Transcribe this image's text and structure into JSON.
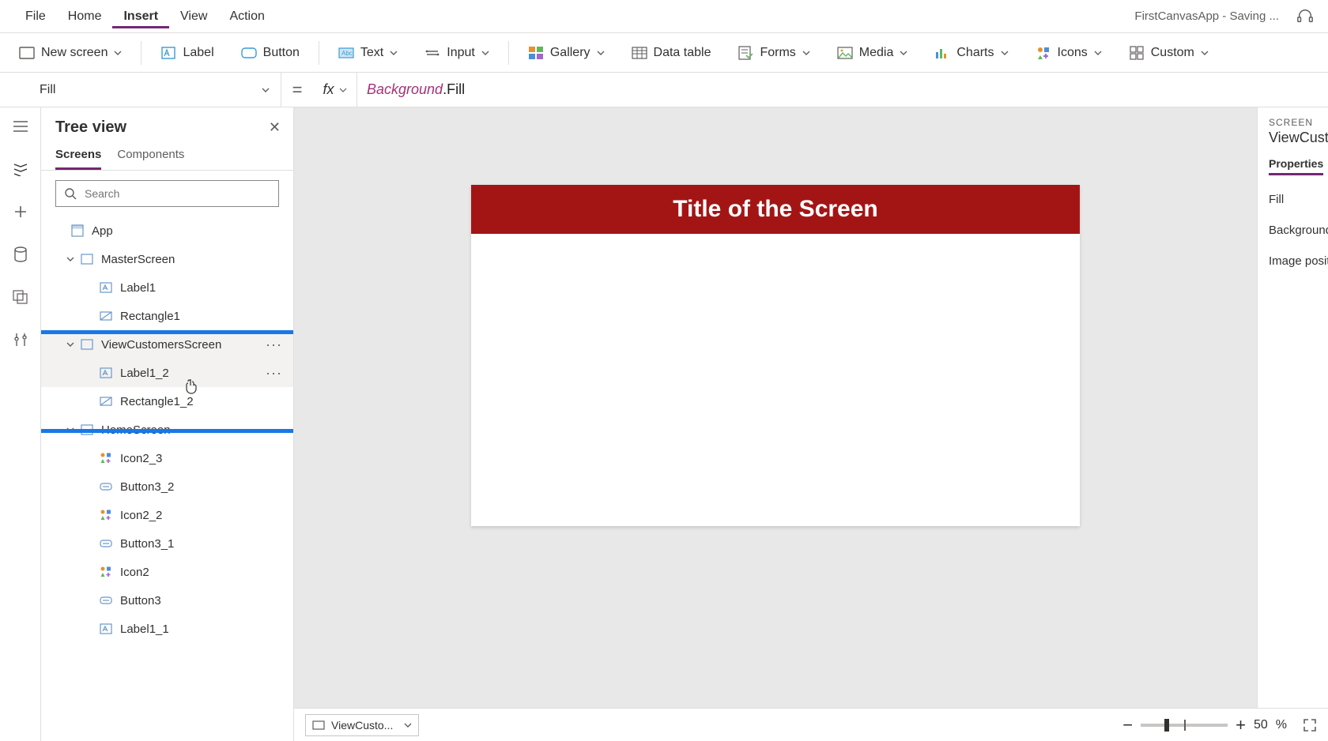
{
  "topbar": {
    "menus": [
      "File",
      "Home",
      "Insert",
      "View",
      "Action"
    ],
    "activeIndex": 2,
    "appTitle": "FirstCanvasApp - Saving ..."
  },
  "ribbon": {
    "newScreen": "New screen",
    "label": "Label",
    "button": "Button",
    "text": "Text",
    "input": "Input",
    "gallery": "Gallery",
    "dataTable": "Data table",
    "forms": "Forms",
    "media": "Media",
    "charts": "Charts",
    "icons": "Icons",
    "custom": "Custom"
  },
  "formula": {
    "property": "Fill",
    "eq": "=",
    "fx": "fx",
    "object": "Background",
    "member": ".Fill"
  },
  "treePanel": {
    "title": "Tree view",
    "tabs": {
      "screens": "Screens",
      "components": "Components",
      "activeIndex": 0
    },
    "searchPlaceholder": "Search",
    "items": [
      {
        "label": "App",
        "depth": 0,
        "type": "app",
        "hasChevron": false
      },
      {
        "label": "MasterScreen",
        "depth": 1,
        "type": "screen",
        "hasChevron": true
      },
      {
        "label": "Label1",
        "depth": 2,
        "type": "label"
      },
      {
        "label": "Rectangle1",
        "depth": 2,
        "type": "rect"
      },
      {
        "label": "ViewCustomersScreen",
        "depth": 1,
        "type": "screen",
        "hasChevron": true,
        "hover": true,
        "showMore": true
      },
      {
        "label": "Label1_2",
        "depth": 2,
        "type": "label",
        "hover": true,
        "showMore": true
      },
      {
        "label": "Rectangle1_2",
        "depth": 2,
        "type": "rect"
      },
      {
        "label": "HomeScreen",
        "depth": 1,
        "type": "screen",
        "hasChevron": true
      },
      {
        "label": "Icon2_3",
        "depth": 2,
        "type": "icon"
      },
      {
        "label": "Button3_2",
        "depth": 2,
        "type": "button"
      },
      {
        "label": "Icon2_2",
        "depth": 2,
        "type": "icon"
      },
      {
        "label": "Button3_1",
        "depth": 2,
        "type": "button"
      },
      {
        "label": "Icon2",
        "depth": 2,
        "type": "icon"
      },
      {
        "label": "Button3",
        "depth": 2,
        "type": "button"
      },
      {
        "label": "Label1_1",
        "depth": 2,
        "type": "label"
      }
    ]
  },
  "canvas": {
    "titleText": "Title of the Screen",
    "titleBg": "#a31515"
  },
  "props": {
    "caption": "SCREEN",
    "name": "ViewCusto",
    "tab": "Properties",
    "rows": [
      "Fill",
      "Background",
      "Image posit"
    ]
  },
  "statusBar": {
    "screenName": "ViewCusto...",
    "zoomValue": "50",
    "zoomPct": "%"
  }
}
